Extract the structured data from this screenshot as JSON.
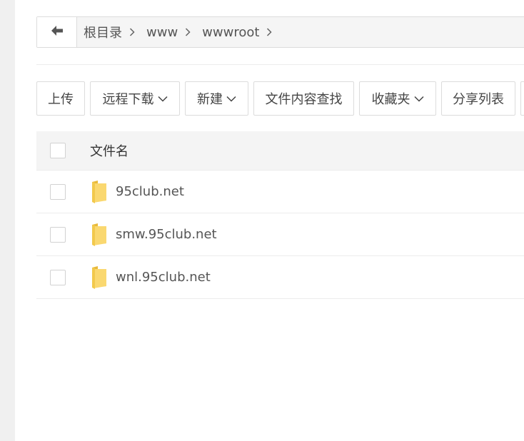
{
  "breadcrumb": {
    "back_icon": "arrow-left-icon",
    "items": [
      "根目录",
      "www",
      "wwwroot"
    ]
  },
  "toolbar": {
    "buttons": [
      {
        "label": "上传",
        "dropdown": false
      },
      {
        "label": "远程下载",
        "dropdown": true
      },
      {
        "label": "新建",
        "dropdown": true
      },
      {
        "label": "文件内容查找",
        "dropdown": false
      },
      {
        "label": "收藏夹",
        "dropdown": true
      },
      {
        "label": "分享列表",
        "dropdown": false
      }
    ]
  },
  "file_table": {
    "column_name": "文件名",
    "rows": [
      {
        "name": "95club.net",
        "type": "folder"
      },
      {
        "name": "smw.95club.net",
        "type": "folder"
      },
      {
        "name": "wnl.95club.net",
        "type": "folder"
      }
    ]
  },
  "colors": {
    "folder": "#f5c542",
    "border": "#dcdcdc",
    "header_bg": "#f4f4f4"
  }
}
